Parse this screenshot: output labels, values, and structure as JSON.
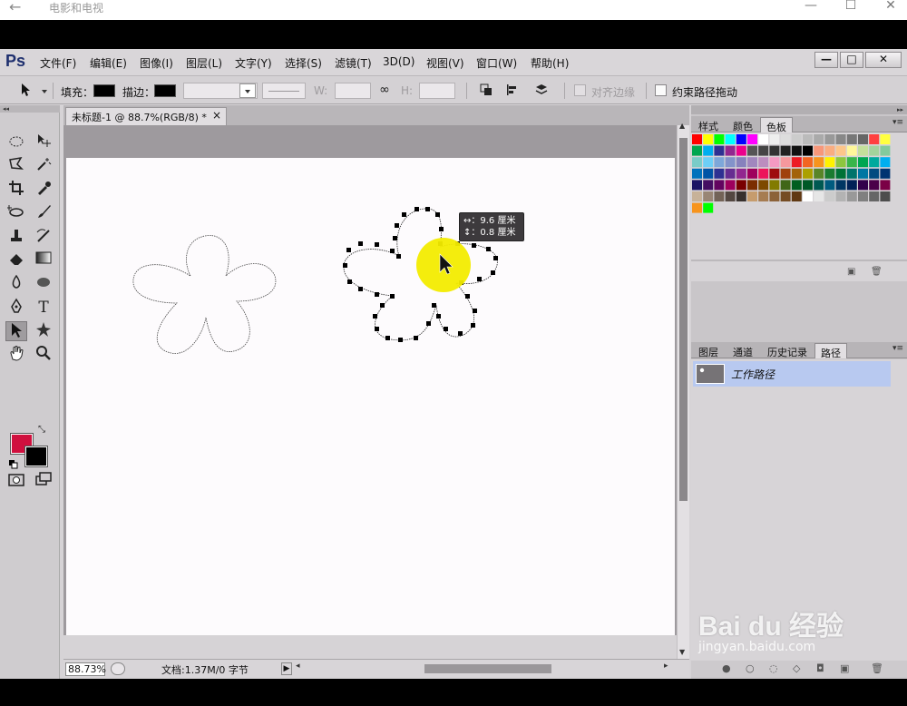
{
  "player": {
    "back_icon": "←",
    "title": "电影和电视",
    "min": "—",
    "max": "☐",
    "close": "✕"
  },
  "app": {
    "logo": "Ps",
    "menu": [
      "文件(F)",
      "编辑(E)",
      "图像(I)",
      "图层(L)",
      "文字(Y)",
      "选择(S)",
      "滤镜(T)",
      "3D(D)",
      "视图(V)",
      "窗口(W)",
      "帮助(H)"
    ],
    "win_min": "—",
    "win_max": "□",
    "win_close": "✕"
  },
  "options": {
    "fill_label": "填充：",
    "stroke_label": "描边：",
    "w_label": "W:",
    "h_label": "H:",
    "align_edges": "对齐边缘",
    "constrain_path": "约束路径拖动",
    "link_icon": "∞"
  },
  "document": {
    "tab_title": "未标题-1 @ 88.7%(RGB/8) *",
    "tab_close": "×",
    "zoom": "88.73%",
    "doc_info": "文档:1.37M/0 字节",
    "tooltip_line1": "↔：9.6 厘米",
    "tooltip_line2": "↕：0.8 厘米"
  },
  "panels": {
    "top_tabs": [
      "样式",
      "颜色",
      "色板"
    ],
    "bottom_tabs": [
      "图层",
      "通道",
      "历史记录",
      "路径"
    ],
    "path_item": "工作路径"
  },
  "colors": {
    "foreground": "#d0103e",
    "background": "#000000",
    "highlight": "#f3ec00"
  },
  "watermark": {
    "main": "Bai du 经验",
    "sub": "jingyan.baidu.com"
  }
}
